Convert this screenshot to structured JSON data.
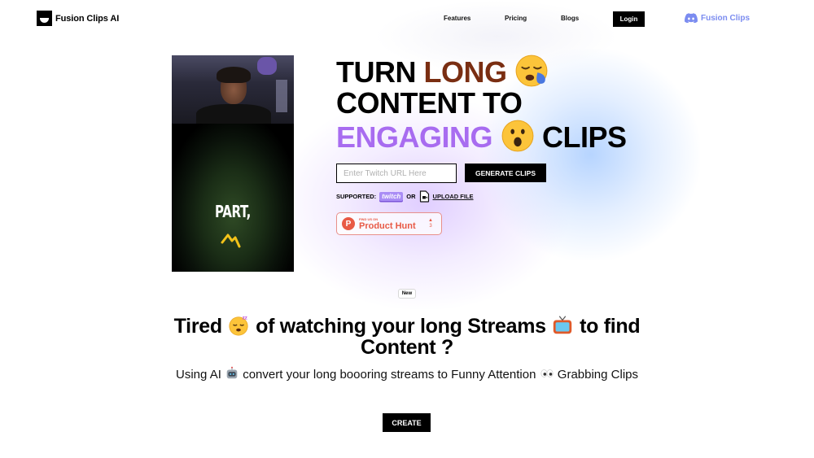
{
  "nav": {
    "brand": "Fusion Clips AI",
    "links": [
      "Features",
      "Pricing",
      "Blogs"
    ],
    "login_label": "Login",
    "discord_label": "Fusion Clips"
  },
  "video": {
    "caption": "PART,"
  },
  "hero": {
    "title_line1_a": "TURN ",
    "title_line1_b": "LONG",
    "title_line2": "CONTENT TO",
    "title_line3_a": "ENGAGING",
    "title_line3_b": "CLIPS",
    "url_placeholder": "Enter Twitch URL Here",
    "url_value": "",
    "generate_label": "GENERATE CLIPS",
    "supported_label": "SUPPORTED:",
    "twitch_label": "twitch",
    "or_label": "OR",
    "upload_label": "UPLOAD FILE",
    "product_hunt": {
      "small": "FIND US ON",
      "big": "Product Hunt",
      "votes": "3"
    },
    "colors": {
      "long": "#7a2e12",
      "engaging": "#a86cf0"
    }
  },
  "section2": {
    "badge": "New",
    "title_a": "Tired",
    "title_b": "of watching your long Streams",
    "title_c": "to find Content ?",
    "subtitle_a": "Using AI",
    "subtitle_b": "convert your long boooring streams to Funny Attention",
    "subtitle_c": "Grabbing Clips",
    "create_label": "CREATE"
  }
}
